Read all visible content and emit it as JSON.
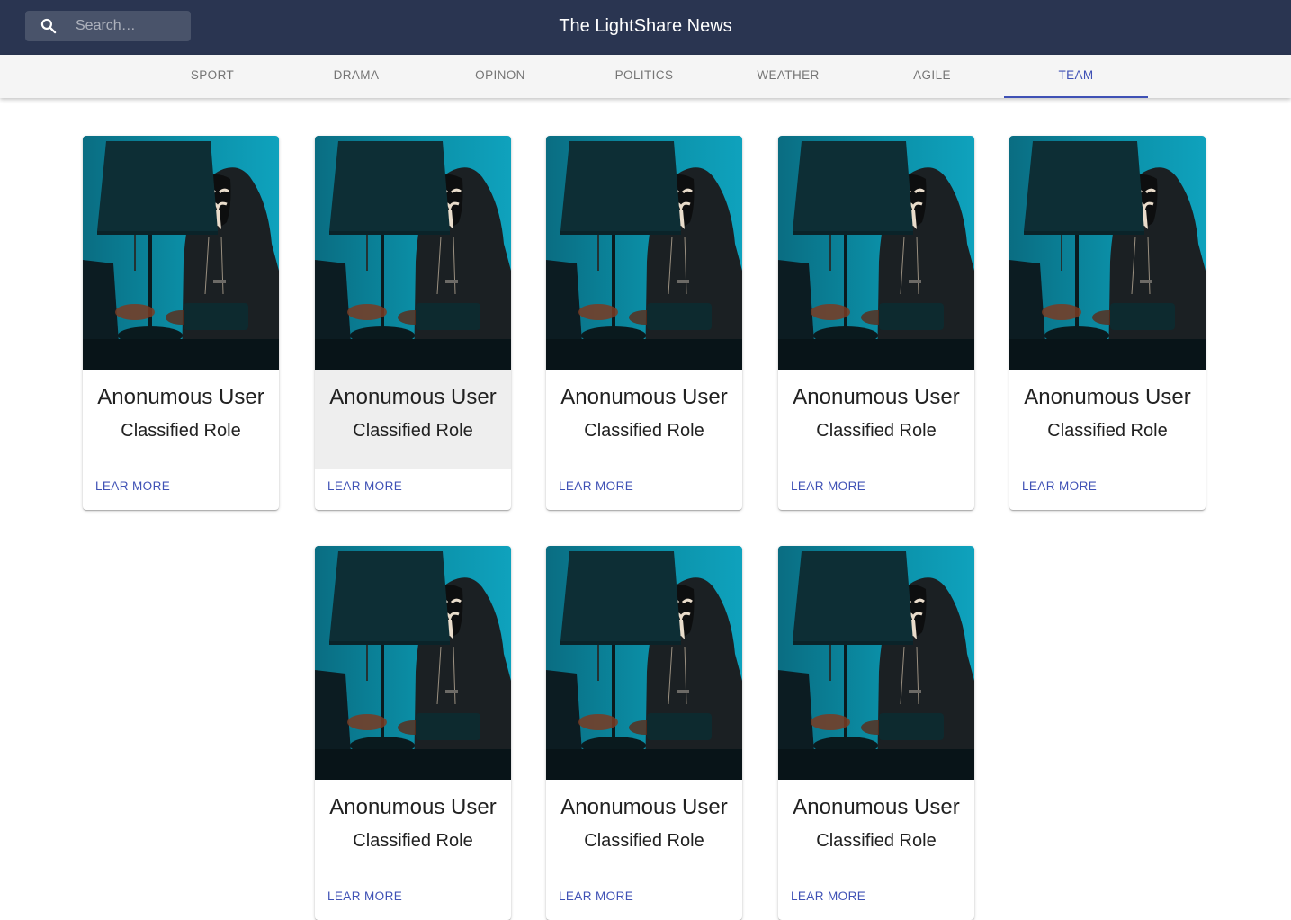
{
  "header": {
    "title": "The LightShare News",
    "search": {
      "placeholder": "Search…",
      "value": ""
    },
    "icon": "search-icon"
  },
  "tabs": [
    {
      "label": "Sport",
      "active": false
    },
    {
      "label": "Drama",
      "active": false
    },
    {
      "label": "Opinon",
      "active": false
    },
    {
      "label": "Politics",
      "active": false
    },
    {
      "label": "Weather",
      "active": false
    },
    {
      "label": "Agile",
      "active": false
    },
    {
      "label": "Team",
      "active": true
    }
  ],
  "team": [
    {
      "name": "Anonumous User",
      "role": "Classified Role",
      "action": "Lear More"
    },
    {
      "name": "Anonumous User",
      "role": "Classified Role",
      "action": "Lear More"
    },
    {
      "name": "Anonumous User",
      "role": "Classified Role",
      "action": "Lear More"
    },
    {
      "name": "Anonumous User",
      "role": "Classified Role",
      "action": "Lear More"
    },
    {
      "name": "Anonumous User",
      "role": "Classified Role",
      "action": "Lear More"
    },
    {
      "name": "Anonumous User",
      "role": "Classified Role",
      "action": "Lear More"
    },
    {
      "name": "Anonumous User",
      "role": "Classified Role",
      "action": "Lear More"
    },
    {
      "name": "Anonumous User",
      "role": "Classified Role",
      "action": "Lear More"
    }
  ],
  "colors": {
    "appbar": "#2a3551",
    "accent": "#3f51b5",
    "tabbar": "#f5f5f5"
  }
}
